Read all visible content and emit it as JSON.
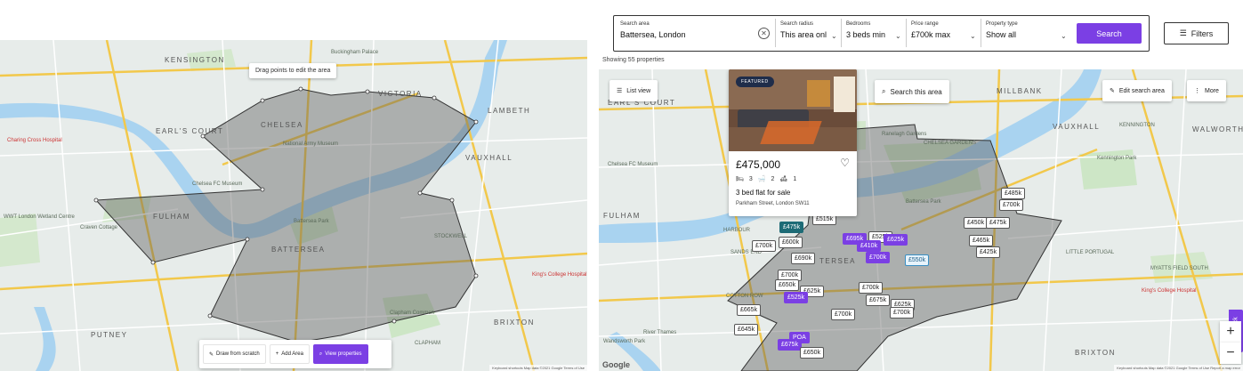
{
  "left_map": {
    "labels": {
      "kensington": "KENSINGTON",
      "earls_court": "EARL'S COURT",
      "chelsea": "CHELSEA",
      "fulham": "FULHAM",
      "battersea": "BATTERSEA",
      "victoria": "VICTORIA",
      "lambeth": "LAMBETH",
      "vauxhall": "VAUXHALL",
      "stockwell": "STOCKWELL",
      "brixton": "BRIXTON",
      "putney": "PUTNEY",
      "clapham": "CLAPHAM"
    },
    "pois": {
      "chelsea_fc": "Chelsea FC Museum",
      "raven_cottage": "Craven Cottage",
      "national_army": "National Army Museum",
      "charing_cross": "Charing Cross Hospital",
      "kings_college": "King's College Hospital",
      "buckingham": "Buckingham Palace",
      "wwt": "WWT London Wetland Centre",
      "battersea_park": "Battersea Park",
      "clapham_common": "Clapham Common"
    },
    "tooltip": "Drag points to edit the area",
    "toolbar": {
      "draw_label": "Draw from scratch",
      "add_label": "Add Area",
      "view_label": "View properties"
    },
    "attribution": "Keyboard shortcuts  Map data ©2021 Google  Terms of Use"
  },
  "search": {
    "area_caption": "Search area",
    "area_value": "Battersea, London",
    "radius_caption": "Search radius",
    "radius_value": "This area onl",
    "bedrooms_caption": "Bedrooms",
    "bedrooms_value": "3 beds min",
    "price_caption": "Price range",
    "price_value": "£700k max",
    "type_caption": "Property type",
    "type_value": "Show all",
    "button_label": "Search",
    "filters_label": "Filters"
  },
  "results": {
    "count_label": "Showing 55 properties"
  },
  "right_map": {
    "list_view_label": "List view",
    "search_this_area_label": "Search this area",
    "edit_area_label": "Edit search area",
    "more_label": "More",
    "feedback_label": "Feedback",
    "google_label": "Google",
    "attribution": "Keyboard shortcuts  Map data ©2021 Google  Terms of Use  Report a map error",
    "labels": {
      "earls_court": "EARL'S COURT",
      "fulham": "FULHAM",
      "battersea": "TERSEA",
      "millbank": "MILLBANK",
      "vauxhall": "VAUXHALL",
      "kennington": "KENNINGTON",
      "walworth": "WALWORTH",
      "little_portugal": "LITTLE PORTUGAL",
      "myatts": "MYATTS FIELD SOUTH",
      "brixton": "BRIXTON",
      "cotton_row": "COTTON ROW",
      "sands_end": "SANDS END",
      "harbour": "HARBOUR",
      "chelsea_fc": "Chelsea FC Museum",
      "kings_college": "King's College Hospital",
      "battersea_park": "Battersea Park",
      "river_thames": "River Thames",
      "wandsworth": "Wandsworth Park",
      "ranelagh": "Ranelagh Gardens",
      "kennington_park": "Kennington Park",
      "chelsea_gardens": "CHELSEA GARDENS"
    },
    "featured_card": {
      "badge": "FEATURED",
      "price": "£475,000",
      "beds": "3",
      "baths": "2",
      "receptions": "1",
      "title": "3 bed flat for sale",
      "address": "Parkham Street, London SW11"
    },
    "pins": [
      {
        "text": "£485k",
        "style": "w"
      },
      {
        "text": "£700k",
        "style": "w"
      },
      {
        "text": "£450k",
        "style": "w"
      },
      {
        "text": "£475k",
        "style": "w"
      },
      {
        "text": "£465k",
        "style": "w"
      },
      {
        "text": "£425k",
        "style": "w"
      },
      {
        "text": "£475k",
        "style": "g"
      },
      {
        "text": "£600k",
        "style": "w"
      },
      {
        "text": "£515k",
        "style": "w"
      },
      {
        "text": "£700k",
        "style": "w"
      },
      {
        "text": "£690k",
        "style": "w"
      },
      {
        "text": "£695k",
        "style": "p"
      },
      {
        "text": "£525k",
        "style": "w"
      },
      {
        "text": "£410k",
        "style": "p"
      },
      {
        "text": "£625k",
        "style": "p"
      },
      {
        "text": "£700k",
        "style": "p"
      },
      {
        "text": "£550k",
        "style": "t"
      },
      {
        "text": "£700k",
        "style": "w"
      },
      {
        "text": "£650k",
        "style": "w"
      },
      {
        "text": "£625k",
        "style": "w"
      },
      {
        "text": "£525k",
        "style": "p"
      },
      {
        "text": "£700k",
        "style": "w"
      },
      {
        "text": "£675k",
        "style": "w"
      },
      {
        "text": "£625k",
        "style": "w"
      },
      {
        "text": "£700k",
        "style": "w"
      },
      {
        "text": "£700k",
        "style": "w"
      },
      {
        "text": "£665k",
        "style": "w"
      },
      {
        "text": "£645k",
        "style": "w"
      },
      {
        "text": "POA",
        "style": "p"
      },
      {
        "text": "£675k",
        "style": "p"
      },
      {
        "text": "£650k",
        "style": "w"
      }
    ]
  },
  "colors": {
    "accent": "#7b3fe4",
    "map_bg": "#e7ecea",
    "park": "#cde6c6",
    "water": "#a9d3f0",
    "polygon": "rgba(90,90,90,0.45)"
  }
}
